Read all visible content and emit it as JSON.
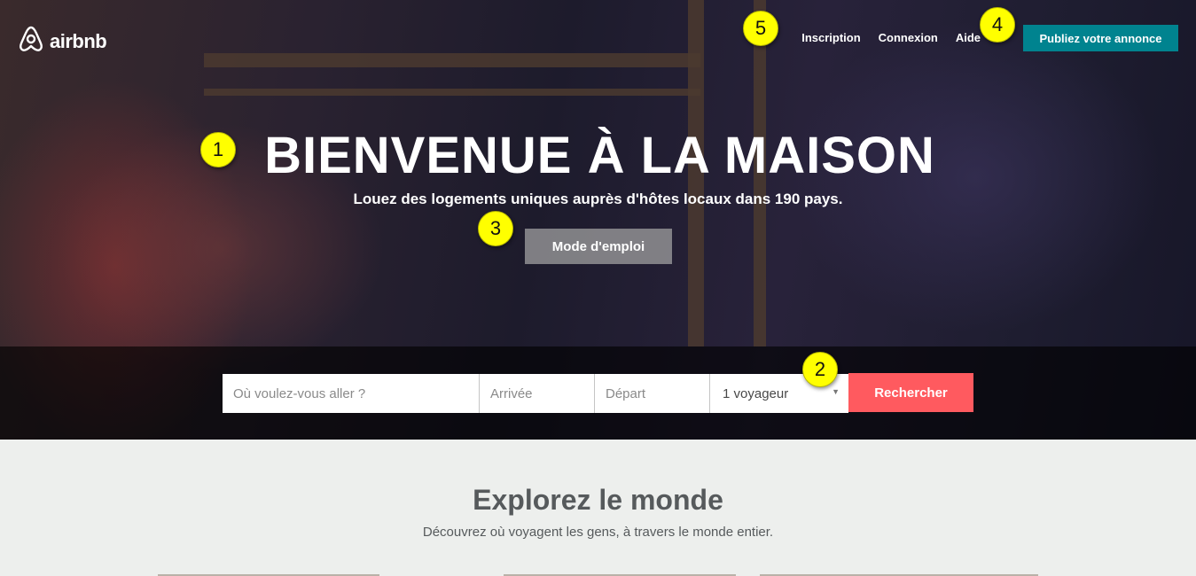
{
  "header": {
    "brand": "airbnb",
    "nav": [
      "Inscription",
      "Connexion",
      "Aide"
    ],
    "cta": "Publiez votre annonce"
  },
  "hero": {
    "title": "BIENVENUE À LA MAISON",
    "subtitle": "Louez des logements uniques auprès d'hôtes locaux dans 190 pays.",
    "howto_button": "Mode d'emploi"
  },
  "search": {
    "where_placeholder": "Où voulez-vous aller ?",
    "checkin_placeholder": "Arrivée",
    "checkout_placeholder": "Départ",
    "guests_value": "1 voyageur",
    "button": "Rechercher"
  },
  "explore": {
    "title": "Explorez le monde",
    "subtitle": "Découvrez où voyagent les gens, à travers le monde entier."
  },
  "markers": [
    "1",
    "2",
    "3",
    "4",
    "5"
  ],
  "colors": {
    "accent": "#ff5a5f",
    "cta": "#00838f",
    "marker": "#ffff00"
  },
  "icons": {
    "logo": "airbnb-belo-icon",
    "dropdown": "caret-down-icon"
  }
}
